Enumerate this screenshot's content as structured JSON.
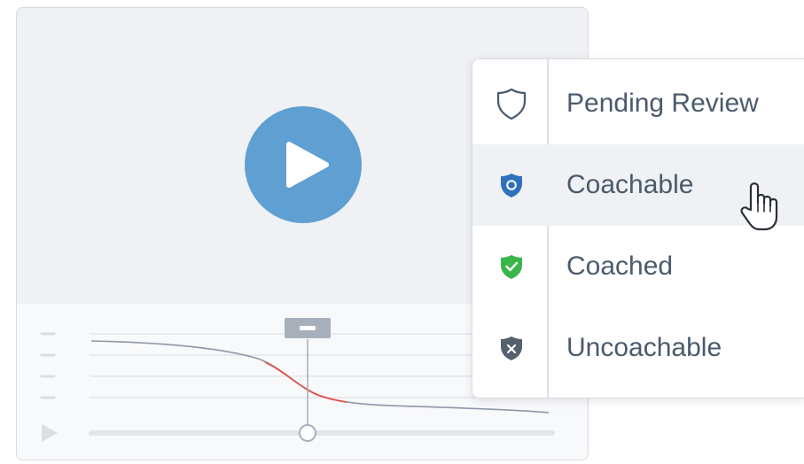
{
  "player": {
    "play_icon": "play-icon",
    "small_play_icon": "play-icon",
    "curve_colors": {
      "base": "#8d97a6",
      "highlight": "#e0524b"
    }
  },
  "status_menu": {
    "items": [
      {
        "label": "Pending Review",
        "icon": "shield-outline-icon",
        "color": "#4b5a6c",
        "hovered": false
      },
      {
        "label": "Coachable",
        "icon": "shield-circle-icon",
        "color": "#2f72bb",
        "hovered": true
      },
      {
        "label": "Coached",
        "icon": "shield-check-icon",
        "color": "#3ab54a",
        "hovered": false
      },
      {
        "label": "Uncoachable",
        "icon": "shield-x-icon",
        "color": "#56606e",
        "hovered": false
      }
    ]
  },
  "cursor": {
    "icon": "hand-pointer-icon"
  }
}
